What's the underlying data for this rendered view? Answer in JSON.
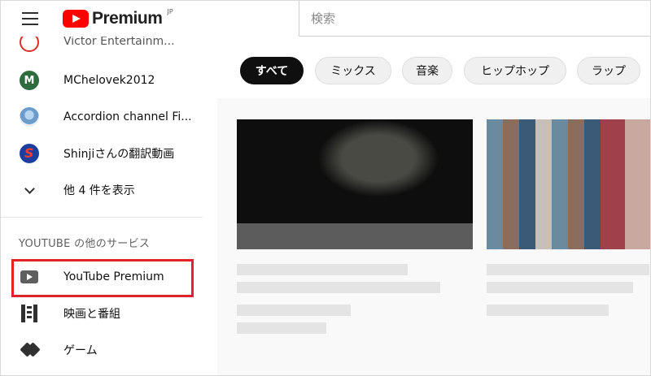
{
  "masthead": {
    "logo_text": "Premium",
    "logo_region": "JP",
    "menu_icon": "hamburger-menu-icon"
  },
  "search": {
    "placeholder": "検索"
  },
  "sidebar": {
    "subscriptions": [
      {
        "label": "Victor Entertainm...",
        "icon": "channel-avatar"
      },
      {
        "label": "MChelovek2012",
        "icon": "channel-avatar",
        "initial": "M"
      },
      {
        "label": "Accordion channel Fi...",
        "icon": "channel-avatar"
      },
      {
        "label": "Shinjiさんの翻訳動画",
        "icon": "channel-avatar"
      }
    ],
    "show_more": "他 4 件を表示",
    "section_title": "YOUTUBE の他のサービス",
    "services": [
      {
        "label": "YouTube Premium",
        "icon": "youtube-icon",
        "highlighted": true
      },
      {
        "label": "映画と番組",
        "icon": "film-icon"
      },
      {
        "label": "ゲーム",
        "icon": "gaming-icon"
      }
    ]
  },
  "chips": [
    {
      "label": "すべて",
      "active": true
    },
    {
      "label": "ミックス",
      "active": false
    },
    {
      "label": "音楽",
      "active": false
    },
    {
      "label": "ヒップホップ",
      "active": false
    },
    {
      "label": "ラップ",
      "active": false
    }
  ],
  "colors": {
    "brand_red": "#ff0000",
    "highlight_box": "#e0232a",
    "active_chip_bg": "#0f0f0f"
  }
}
